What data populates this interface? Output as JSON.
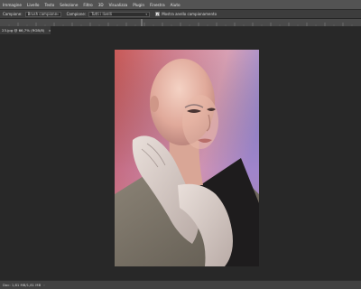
{
  "menubar": {
    "items": [
      "Immagine",
      "Livello",
      "Testo",
      "Selezione",
      "Filtro",
      "3D",
      "Visualizza",
      "Plugin",
      "Finestra",
      "Aiuto"
    ]
  },
  "options": {
    "sample_label": "Campione:",
    "sample_value": "Brush campione",
    "sample2_label": "Campione:",
    "sample2_value": "Tutti i livelli",
    "checkbox_label": "Mostra anello campionamento",
    "checkbox_checked": true
  },
  "document": {
    "tab_title": "23.jpg @ 66,7% (RGB/8)",
    "close_glyph": "×"
  },
  "status": {
    "text": "Doc: 1,81 MB/1,81 MB",
    "arrow": "›"
  },
  "colors": {
    "menubar_bg": "#535353",
    "workspace_bg": "#282828",
    "photo_bg_left": "#d98a7a",
    "photo_bg_right": "#9f8fd6"
  },
  "icons": {
    "close": "close-icon",
    "dropdown": "chevron-down-icon",
    "checkbox": "checkbox-icon"
  }
}
